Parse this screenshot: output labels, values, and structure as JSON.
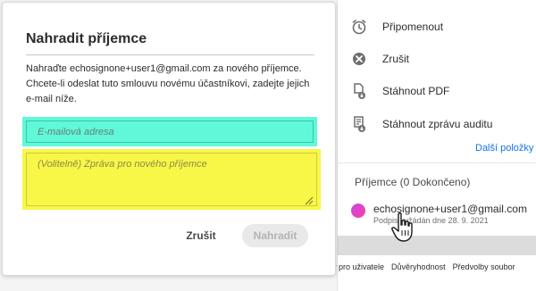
{
  "side_panel": {
    "actions": [
      {
        "label": "Připomenout",
        "icon": "clock-icon"
      },
      {
        "label": "Zrušit",
        "icon": "cancel-circle-icon"
      },
      {
        "label": "Stáhnout PDF",
        "icon": "download-pdf-icon"
      },
      {
        "label": "Stáhnout zprávu auditu",
        "icon": "download-audit-icon"
      }
    ],
    "more_link": "Další položky",
    "recipients_heading": "Příjemce (0 Dokončeno)",
    "recipient": {
      "email": "echosignone+user1@gmail.com",
      "status": "Podpis vyžádán dne 28. 9. 2021"
    }
  },
  "footer": {
    "links": [
      "ínky pro uživatele",
      "Důvěryhodnost",
      "Předvolby soubor"
    ]
  },
  "modal": {
    "title": "Nahradit příjemce",
    "description": "Nahraďte echosignone+user1@gmail.com za nového příjemce. Chcete-li odeslat tuto smlouvu novému účastníkovi, zadejte jejich e-mail níže.",
    "email_placeholder": "E-mailová adresa",
    "message_placeholder": "(Volitelně) Zpráva pro nového příjemce",
    "cancel_label": "Zrušit",
    "replace_label": "Nahradit"
  },
  "colors": {
    "accent_link": "#1473e6",
    "email_highlight": "#5ff8d8",
    "message_highlight": "#f8f747",
    "avatar_gradient_start": "#c24fe0",
    "avatar_gradient_end": "#ff3aa8"
  }
}
